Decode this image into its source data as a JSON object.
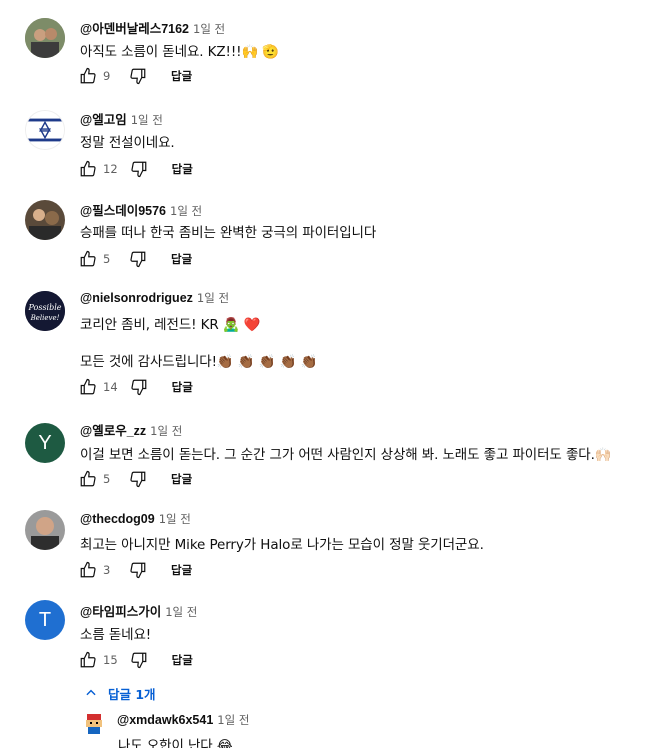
{
  "comments": [
    {
      "author": "@아덴버날레스7162",
      "time": "1일 전",
      "text": "아직도 소름이 돋네요. KZ!!!🙌 🫡",
      "likes": "9",
      "reply_label": "답글"
    },
    {
      "author": "@엘고임",
      "time": "1일 전",
      "text": "정말 전설이네요.",
      "likes": "12",
      "reply_label": "답글"
    },
    {
      "author": "@필스데이9576",
      "time": "1일 전",
      "text": "승패를 떠나 한국 좀비는 완벽한 궁극의 파이터입니다",
      "likes": "5",
      "reply_label": "답글"
    },
    {
      "author": "@nielsonrodriguez",
      "time": "1일 전",
      "text": "코리안 좀비, 레전드! KR 🧟‍♂️ ❤️",
      "text2": "모든 것에 감사드립니다!👏🏾 👏🏾 👏🏾 👏🏾 👏🏾",
      "likes": "14",
      "reply_label": "답글"
    },
    {
      "author": "@옐로우_zz",
      "time": "1일 전",
      "avatar_letter": "Y",
      "text": "이걸 보면 소름이 돋는다. 그 순간 그가 어떤 사람인지 상상해 봐. 노래도 좋고 파이터도 좋다.🙌🏻",
      "likes": "5",
      "reply_label": "답글"
    },
    {
      "author": "@thecdog09",
      "time": "1일 전",
      "text": "최고는 아니지만 Mike Perry가 Halo로 나가는 모습이 정말 웃기더군요.",
      "likes": "3",
      "reply_label": "답글"
    },
    {
      "author": "@타임피스가이",
      "time": "1일 전",
      "avatar_letter": "T",
      "text": "소름 돋네요!",
      "likes": "15",
      "reply_label": "답글"
    }
  ],
  "replies_toggle": "답글 1개",
  "reply": {
    "author": "@xmdawk6x541",
    "time": "1일 전",
    "text": "나도 오한이 난다 😂"
  },
  "colors": {
    "link": "#065fd4",
    "secondary": "#606060",
    "avatar_y": "#1e5a42",
    "avatar_t": "#1f6fd1"
  }
}
